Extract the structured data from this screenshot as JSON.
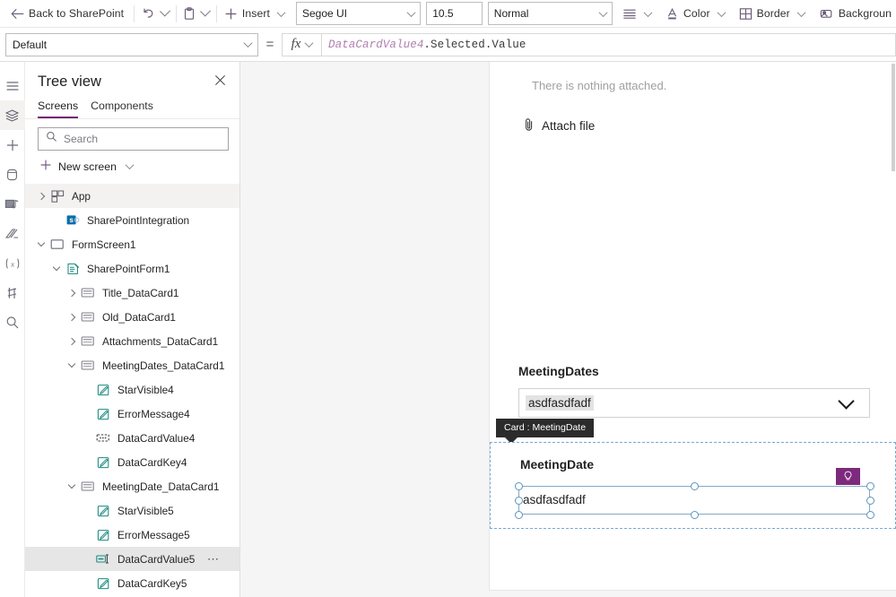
{
  "commandbar": {
    "back_label": "Back to SharePoint",
    "back_icon": "arrow-left-icon",
    "undo_icon": "undo-icon",
    "paste_icon": "clipboard-icon",
    "insert_label": "Insert",
    "insert_icon": "plus-icon",
    "font_family_value": "Segoe UI",
    "font_size_value": "10.5",
    "font_weight_value": "Normal",
    "align_icon": "align-lines-icon",
    "color_label": "Color",
    "color_icon": "font-color-icon",
    "border_label": "Border",
    "border_icon": "border-grid-icon",
    "background_label": "Backgroun",
    "background_icon": "paint-bucket-icon"
  },
  "formulabar": {
    "property_value": "Default",
    "equals": "=",
    "fx_label": "fx",
    "formula_control": "DataCardValue4",
    "formula_property": ".Selected.Value"
  },
  "rail": {
    "items": [
      {
        "icon": "hamburger-menu-icon",
        "active": false
      },
      {
        "icon": "layers-tree-view-icon",
        "active": true
      },
      {
        "icon": "plus-insert-icon",
        "active": false
      },
      {
        "icon": "database-data-icon",
        "active": false
      },
      {
        "icon": "media-icon",
        "active": false
      },
      {
        "icon": "power-automate-flow-icon",
        "active": false
      },
      {
        "icon": "variables-x-icon",
        "active": false
      },
      {
        "icon": "advanced-tools-icon",
        "active": false
      },
      {
        "icon": "search-icon",
        "active": false
      }
    ]
  },
  "treeview": {
    "title": "Tree view",
    "close_icon": "close-icon",
    "tabs": [
      {
        "label": "Screens",
        "active": true
      },
      {
        "label": "Components",
        "active": false
      }
    ],
    "search_placeholder": "Search",
    "search_icon": "search-icon",
    "search_value": "",
    "new_screen_label": "New screen",
    "new_screen_icon": "plus-icon",
    "items": [
      {
        "label": "App",
        "indent": 0,
        "twisty": "right",
        "icon": "app-grid-icon",
        "state": "hover"
      },
      {
        "label": "SharePointIntegration",
        "indent": 1,
        "twisty": "none",
        "icon": "sharepoint-icon",
        "state": "none"
      },
      {
        "label": "FormScreen1",
        "indent": 0,
        "twisty": "down",
        "icon": "screen-icon",
        "state": "none"
      },
      {
        "label": "SharePointForm1",
        "indent": 1,
        "twisty": "down",
        "icon": "form-icon",
        "state": "none"
      },
      {
        "label": "Title_DataCard1",
        "indent": 2,
        "twisty": "right",
        "icon": "datacard-icon",
        "state": "none"
      },
      {
        "label": "Old_DataCard1",
        "indent": 2,
        "twisty": "right",
        "icon": "datacard-icon",
        "state": "none"
      },
      {
        "label": "Attachments_DataCard1",
        "indent": 2,
        "twisty": "right",
        "icon": "datacard-icon",
        "state": "none"
      },
      {
        "label": "MeetingDates_DataCard1",
        "indent": 2,
        "twisty": "down",
        "icon": "datacard-icon",
        "state": "none"
      },
      {
        "label": "StarVisible4",
        "indent": 3,
        "twisty": "none",
        "icon": "label-pencil-icon",
        "state": "none"
      },
      {
        "label": "ErrorMessage4",
        "indent": 3,
        "twisty": "none",
        "icon": "label-pencil-icon",
        "state": "none"
      },
      {
        "label": "DataCardValue4",
        "indent": 3,
        "twisty": "none",
        "icon": "dropdown-control-icon",
        "state": "none"
      },
      {
        "label": "DataCardKey4",
        "indent": 3,
        "twisty": "none",
        "icon": "label-pencil-icon",
        "state": "none"
      },
      {
        "label": "MeetingDate_DataCard1",
        "indent": 2,
        "twisty": "down",
        "icon": "datacard-icon",
        "state": "none"
      },
      {
        "label": "StarVisible5",
        "indent": 3,
        "twisty": "none",
        "icon": "label-pencil-icon",
        "state": "none"
      },
      {
        "label": "ErrorMessage5",
        "indent": 3,
        "twisty": "none",
        "icon": "label-pencil-icon",
        "state": "none"
      },
      {
        "label": "DataCardValue5",
        "indent": 3,
        "twisty": "none",
        "icon": "text-input-control-icon",
        "state": "selected",
        "overflow": "⋯"
      },
      {
        "label": "DataCardKey5",
        "indent": 3,
        "twisty": "none",
        "icon": "label-pencil-icon",
        "state": "none"
      }
    ]
  },
  "canvas": {
    "attachments_empty_text": "There is nothing attached.",
    "attach_file_label": "Attach file",
    "attach_file_icon": "paperclip-icon",
    "meeting_dates_label": "MeetingDates",
    "meeting_dates_value": "asdfasdfadf",
    "dropdown_chevron_icon": "chevron-down-icon",
    "tooltip_text": "Card : MeetingDate",
    "meeting_date_label": "MeetingDate",
    "meeting_date_value": "asdfasdfadf",
    "lightbulb_icon": "lightbulb-icon"
  },
  "colors": {
    "accent_purple": "#742774",
    "badge_purple": "#7c2a7c",
    "selection_blue": "#5b96bd",
    "card_dash_blue": "#7aa6d2",
    "tree_icon_teal": "#1a8a7f",
    "tooltip_bg": "#2b2b2b",
    "formula_control": "#b07fb0"
  }
}
